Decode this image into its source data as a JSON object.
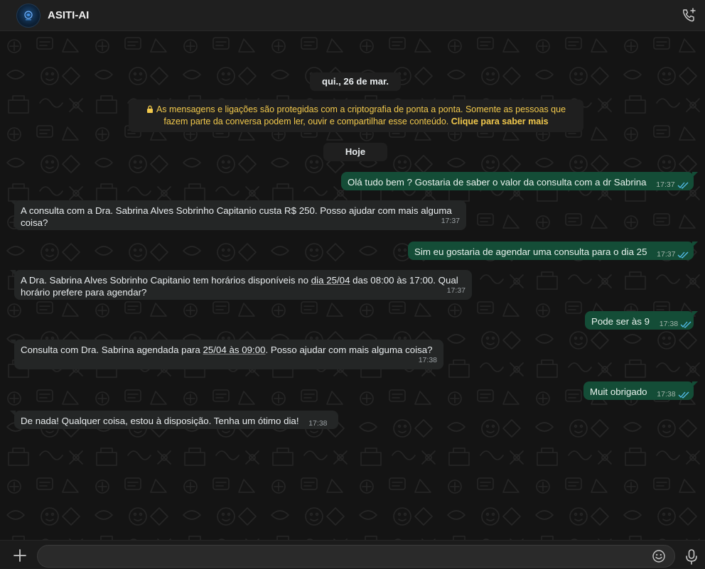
{
  "header": {
    "title": "ASITI-AI",
    "avatar_icon": "brain-logo-icon",
    "call_icon": "phone-add-icon"
  },
  "chat": {
    "date_label": "qui., 26 de mar.",
    "encryption": {
      "text": "As mensagens e ligações são protegidas com a criptografia de ponta a ponta. Somente as pessoas que fazem parte da conversa podem ler, ouvir e compartilhar esse conteúdo.",
      "link": "Clique para saber mais",
      "icon": "lock-icon"
    },
    "today_label": "Hoje",
    "messages": [
      {
        "dir": "out",
        "text": "Olá tudo bem ? Gostaria de saber o valor da consulta com a dr Sabrina",
        "time": "17:37"
      },
      {
        "dir": "in",
        "text_line1": "A consulta com a Dra. Sabrina Alves Sobrinho Capitanio custa R$ 250. Posso ajudar com mais alguma",
        "text_line2": "coisa?",
        "time": "17:37"
      },
      {
        "dir": "out",
        "text": "Sim eu gostaria de agendar uma consulta para o dia 25",
        "time": "17:37"
      },
      {
        "dir": "in",
        "text_line1_a": "A Dra. Sabrina Alves Sobrinho Capitanio tem horários disponíveis no ",
        "text_line1_link": "dia 25/04",
        "text_line1_b": " das 08:00 às 17:00. Qual",
        "text_line2": "horário prefere para agendar?",
        "time": "17:37"
      },
      {
        "dir": "out",
        "text": "Pode ser às 9",
        "time": "17:38"
      },
      {
        "dir": "in",
        "text_a": "Consulta com Dra. Sabrina agendada para ",
        "text_link": "25/04 às 09:00",
        "text_b": ". Posso ajudar com mais alguma coisa?",
        "time": "17:38"
      },
      {
        "dir": "out",
        "text": "Muit obrigado",
        "time": "17:38"
      },
      {
        "dir": "in",
        "text": "De nada! Qualquer coisa, estou à disposição. Tenha um ótimo dia!",
        "time": "17:38"
      }
    ]
  },
  "composer": {
    "placeholder": "",
    "value": "",
    "attach_icon": "plus-icon",
    "emoji_icon": "emoji-icon",
    "mic_icon": "microphone-icon"
  },
  "colors": {
    "outgoing_bubble": "#144d37",
    "incoming_bubble": "#242626",
    "read_ticks": "#53bdeb",
    "encryption_text": "#f2c94c"
  }
}
